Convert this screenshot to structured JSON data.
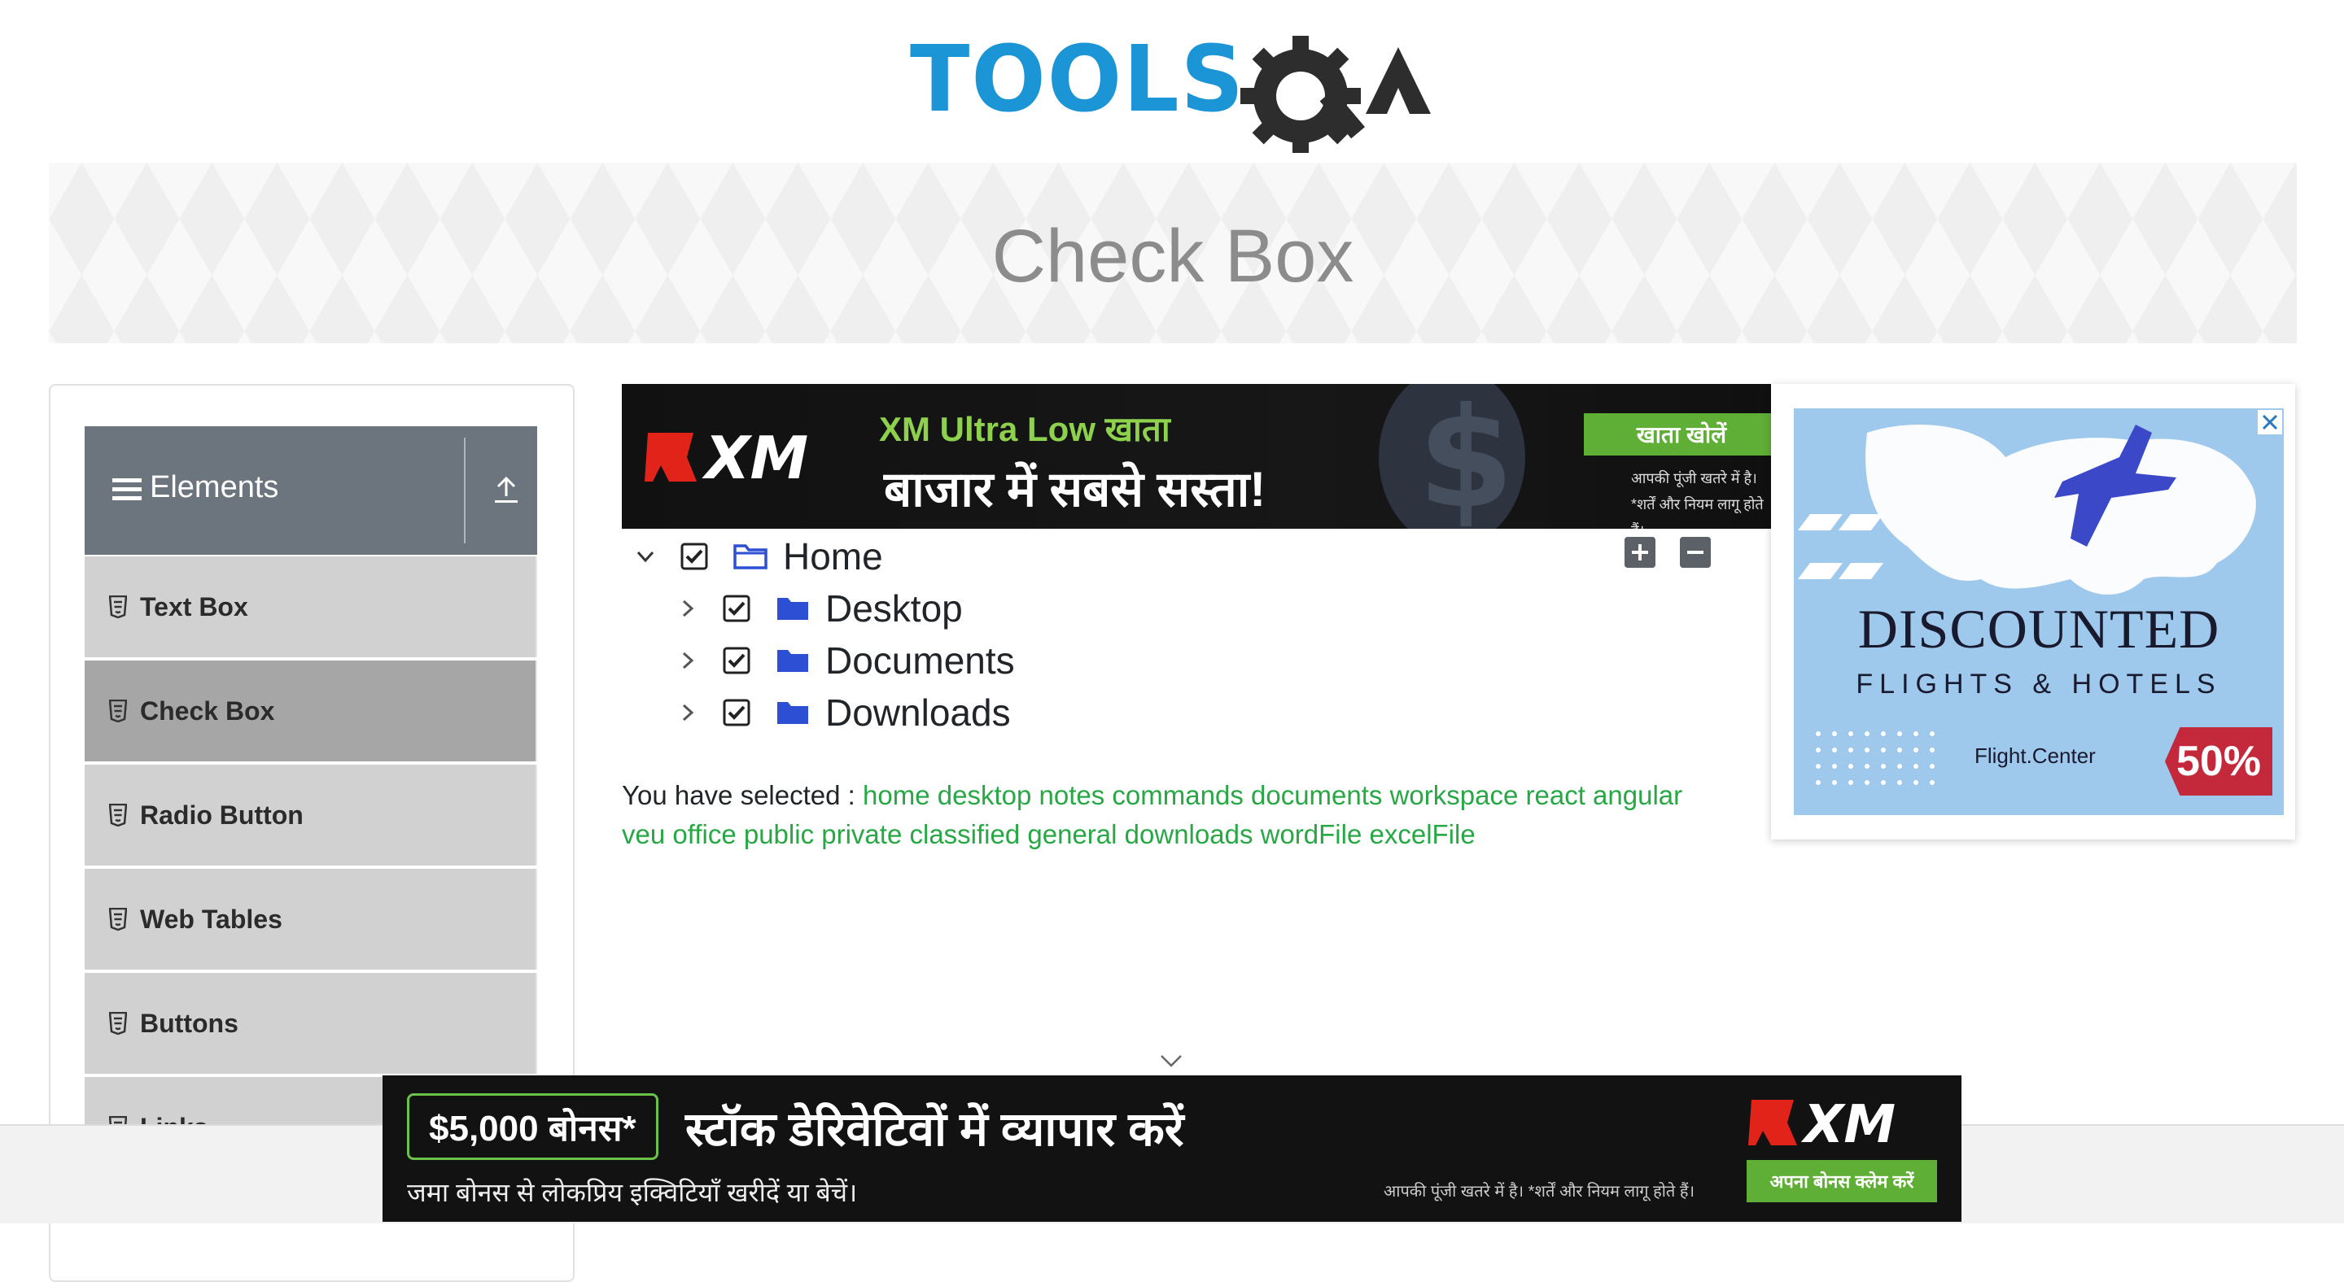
{
  "header": {
    "logo_text": "TOOLSQA",
    "page_title": "Check Box"
  },
  "sidebar": {
    "group_title": "Elements",
    "items": [
      {
        "label": "Text Box",
        "active": false
      },
      {
        "label": "Check Box",
        "active": true
      },
      {
        "label": "Radio Button",
        "active": false
      },
      {
        "label": "Web Tables",
        "active": false
      },
      {
        "label": "Buttons",
        "active": false
      },
      {
        "label": "Links",
        "active": false
      }
    ]
  },
  "ad_top": {
    "brand": "XM",
    "line1": "XM Ultra Low खाता",
    "line2": "बाजार में सबसे सस्ता!",
    "cta": "खाता खोलें",
    "note": "आपकी पूंजी खतरे में है। *शर्तें और नियम लागू होते हैं।"
  },
  "tree": {
    "root": {
      "label": "Home",
      "checked": true,
      "expanded": true
    },
    "children": [
      {
        "label": "Desktop",
        "checked": true,
        "expanded": false
      },
      {
        "label": "Documents",
        "checked": true,
        "expanded": false
      },
      {
        "label": "Downloads",
        "checked": true,
        "expanded": false
      }
    ],
    "expand_all_icon": "plus-square-icon",
    "collapse_all_icon": "minus-square-icon"
  },
  "result": {
    "prefix": "You have selected :",
    "items": [
      "home",
      "desktop",
      "notes",
      "commands",
      "documents",
      "workspace",
      "react",
      "angular",
      "veu",
      "office",
      "public",
      "private",
      "classified",
      "general",
      "downloads",
      "wordFile",
      "excelFile"
    ]
  },
  "ad_right": {
    "headline": "DISCOUNTED",
    "subline": "FLIGHTS & HOTELS",
    "brand": "Flight.Center",
    "discount": "50%"
  },
  "ad_bottom": {
    "bonus": "$5,000 बोनस*",
    "headline": "स्टॉक डेरिवेटिवों में व्यापार करें",
    "subline": "जमा बोनस से लोकप्रिय इक्विटियाँ खरीदें या बेचें।",
    "note": "आपकी पूंजी खतरे में है। *शर्तें और नियम लागू होते हैं।",
    "brand": "XM",
    "cta": "अपना बोनस क्लेम करें"
  },
  "colors": {
    "accent_green": "#28a745",
    "sidebar_header": "#6c757d",
    "active_item": "#a6a6a6",
    "logo_blue": "#1b95d6",
    "ad_green": "#5fae36"
  }
}
